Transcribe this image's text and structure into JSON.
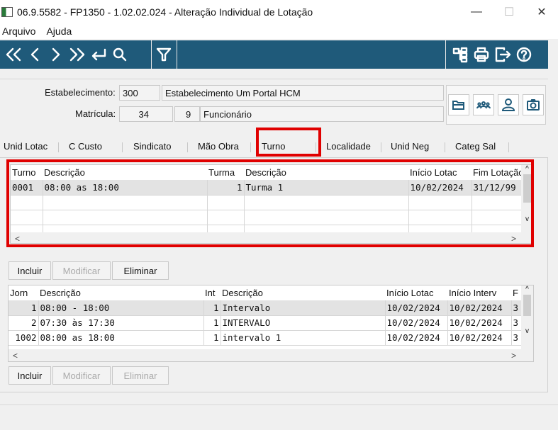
{
  "window": {
    "title": "06.9.5582 - FP1350 - 1.02.02.024 - Alteração Individual de Lotação",
    "minimize": "—",
    "maximize": "☐",
    "close": "✕"
  },
  "menu": {
    "items": [
      "Arquivo",
      "Ajuda"
    ]
  },
  "colors": {
    "toolbar": "#1f5a7a",
    "highlight": "#e00000",
    "active_tab": "#1e90d0"
  },
  "header": {
    "estabelecimento_label": "Estabelecimento:",
    "estabelecimento_code": "300",
    "estabelecimento_name": "Estabelecimento Um Portal HCM",
    "matricula_label": "Matrícula:",
    "matricula_value": "34",
    "matricula_digit": "9",
    "matricula_type": "Funcionário"
  },
  "tabs": [
    "Unid Lotac",
    "C Custo",
    "Sindicato",
    "Mão Obra",
    "Turno",
    "Localidade",
    "Unid Neg",
    "Categ Sal"
  ],
  "active_tab": "Turno",
  "turno_grid": {
    "columns": [
      "Turno",
      "Descrição",
      "Turma",
      "Descrição",
      "Início Lotac",
      "Fim Lotação"
    ],
    "rows": [
      [
        "0001",
        "08:00 as 18:00",
        "1",
        "Turma 1",
        "10/02/2024",
        "31/12/99"
      ]
    ]
  },
  "buttons1": {
    "incluir": "Incluir",
    "modificar": "Modificar",
    "eliminar": "Eliminar"
  },
  "jornada_grid": {
    "columns": [
      "Jorn",
      "Descrição",
      "Int",
      "Descrição",
      "Início Lotac",
      "Início Interv",
      "F"
    ],
    "rows": [
      [
        "1",
        "08:00 - 18:00",
        "1",
        "Intervalo",
        "10/02/2024",
        "10/02/2024",
        "3"
      ],
      [
        "2",
        "07:30 às 17:30",
        "1",
        "INTERVALO",
        "10/02/2024",
        "10/02/2024",
        "3"
      ],
      [
        "1002",
        "08:00 as 18:00",
        "1",
        "intervalo 1",
        "10/02/2024",
        "10/02/2024",
        "3"
      ]
    ]
  },
  "buttons2": {
    "incluir": "Incluir",
    "modificar": "Modificar",
    "eliminar": "Eliminar"
  }
}
